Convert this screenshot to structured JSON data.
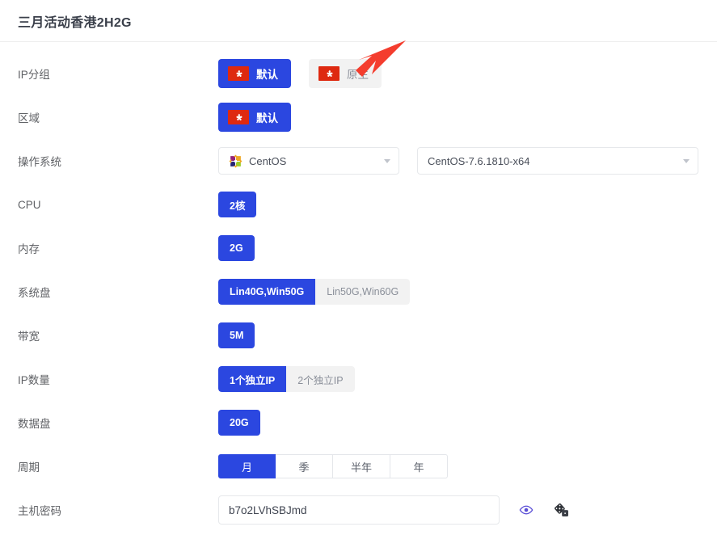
{
  "header": {
    "title": "三月活动香港2H2G"
  },
  "colors": {
    "accent_blue": "#2b47e0",
    "unselected_gray_bg": "#f2f2f2",
    "unselected_gray_text": "#8a8f99",
    "flag_red": "#de2910",
    "label_text": "#606266",
    "annotation_red": "#f43d2e",
    "eye_icon": "#5b4fd6",
    "dice_icon": "#2f3238"
  },
  "rows": [
    {
      "label": "IP分组",
      "type": "flag-chips",
      "options": [
        {
          "text": "默认",
          "icon": "hong-kong-flag-icon",
          "selected": true
        },
        {
          "text": "原生",
          "icon": "hong-kong-flag-icon",
          "selected": false
        }
      ]
    },
    {
      "label": "区域",
      "type": "flag-chips",
      "options": [
        {
          "text": "默认",
          "icon": "hong-kong-flag-icon",
          "selected": true
        }
      ]
    },
    {
      "label": "操作系统",
      "type": "selects",
      "selects": [
        {
          "name": "os-family-select",
          "value": "CentOS",
          "icon": "centos-logo-icon"
        },
        {
          "name": "os-version-select",
          "value": "CentOS-7.6.1810-x64",
          "icon": null
        }
      ]
    },
    {
      "label": "CPU",
      "type": "chips",
      "options": [
        {
          "text": "2核",
          "selected": true
        }
      ]
    },
    {
      "label": "内存",
      "type": "chips",
      "options": [
        {
          "text": "2G",
          "selected": true
        }
      ]
    },
    {
      "label": "系统盘",
      "type": "chip-pair",
      "options": [
        {
          "text": "Lin40G,Win50G",
          "selected": true
        },
        {
          "text": "Lin50G,Win60G",
          "selected": false
        }
      ]
    },
    {
      "label": "带宽",
      "type": "chips",
      "options": [
        {
          "text": "5M",
          "selected": true
        }
      ]
    },
    {
      "label": "IP数量",
      "type": "chip-pair",
      "options": [
        {
          "text": "1个独立IP",
          "selected": true
        },
        {
          "text": "2个独立IP",
          "selected": false
        }
      ]
    },
    {
      "label": "数据盘",
      "type": "chips",
      "options": [
        {
          "text": "20G",
          "selected": true
        }
      ]
    },
    {
      "label": "周期",
      "type": "segmented",
      "options": [
        {
          "text": "月",
          "selected": true
        },
        {
          "text": "季",
          "selected": false
        },
        {
          "text": "半年",
          "selected": false
        },
        {
          "text": "年",
          "selected": false
        }
      ]
    },
    {
      "label": "主机密码",
      "type": "password",
      "password": {
        "value": "b7o2LVhSBJmd",
        "placeholder": "",
        "toggle_icon": "eye-icon",
        "generate_icon": "dice-icon"
      }
    }
  ],
  "annotation": {
    "type": "arrow",
    "points_to": "原生",
    "color": "#f43d2e"
  }
}
